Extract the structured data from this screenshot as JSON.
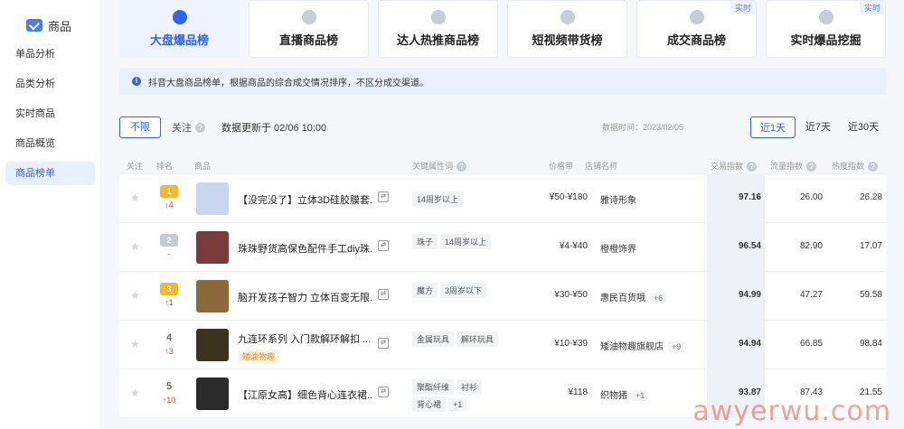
{
  "sidebar": {
    "title": "商品",
    "items": [
      {
        "label": "单品分析",
        "active": false
      },
      {
        "label": "品类分析",
        "active": false
      },
      {
        "label": "实时商品",
        "active": false
      },
      {
        "label": "商品概览",
        "active": false
      },
      {
        "label": "商品榜单",
        "active": true
      }
    ]
  },
  "tabs": [
    {
      "label": "大盘爆品榜",
      "active": true,
      "badge": ""
    },
    {
      "label": "直播商品榜",
      "active": false,
      "badge": ""
    },
    {
      "label": "达人热推商品榜",
      "active": false,
      "badge": ""
    },
    {
      "label": "短视频带货榜",
      "active": false,
      "badge": ""
    },
    {
      "label": "成交商品榜",
      "active": false,
      "badge": "实时"
    },
    {
      "label": "实时爆品挖掘",
      "active": false,
      "badge": "实时"
    }
  ],
  "notice": {
    "icon": "i",
    "text": "抖音大盘商品榜单，根据商品的综合成交情况排序，不区分成交渠道。"
  },
  "filter": {
    "all_label": "不限",
    "follow_label": "关注",
    "update_text": "数据更新于 02/06 10:00",
    "date_text": "数据时间：2023/02/05",
    "ranges": [
      {
        "label": "近1天",
        "active": true
      },
      {
        "label": "近7天",
        "active": false
      },
      {
        "label": "近30天",
        "active": false
      }
    ]
  },
  "table": {
    "headers": {
      "follow": "关注",
      "rank": "排名",
      "product": "商品",
      "attrs": "关键属性词",
      "price": "价格带",
      "shop": "店铺名称",
      "trade": "交易指数",
      "traffic": "流量指数",
      "heat": "热度指数"
    },
    "rows": [
      {
        "crown": "1",
        "crown_color": "gold",
        "rank": "",
        "delta": "↑4",
        "name": "【没完没了】立体3D硅胶膜套...",
        "shop_tag": "",
        "attrs": [
          "14周岁以上"
        ],
        "price": "¥50-¥180",
        "shop": "雅诗形象",
        "shop_more": "",
        "trade": "97.16",
        "traffic": "26.00",
        "heat": "26.28",
        "thumb": "#c9d6f2"
      },
      {
        "crown": "2",
        "crown_color": "silver",
        "rank": "",
        "delta": "-",
        "name": "珠珠野货高保色配件手工diy珠...",
        "shop_tag": "",
        "attrs": [
          "珠子",
          "14周岁以上"
        ],
        "price": "¥4-¥40",
        "shop": "橙橙饰界",
        "shop_more": "",
        "trade": "96.54",
        "traffic": "82.90",
        "heat": "17.07",
        "thumb": "#7a3b3b"
      },
      {
        "crown": "3",
        "crown_color": "gold",
        "rank": "",
        "delta": "↑1",
        "name": "脑开发孩子智力 立体百变无限...",
        "shop_tag": "",
        "attrs": [
          "魔方",
          "3周岁以下"
        ],
        "price": "¥30-¥50",
        "shop": "惠民百货哦",
        "shop_more": "+6",
        "trade": "94.99",
        "traffic": "47.27",
        "heat": "59.58",
        "thumb": "#8a6a3a"
      },
      {
        "crown": "",
        "crown_color": "",
        "rank": "4",
        "delta": "↑3",
        "name": "九连环系列 入门款解环解扣 ...",
        "shop_tag": "矮油物趣",
        "attrs": [
          "金属玩具",
          "解环玩具"
        ],
        "price": "¥10-¥39",
        "shop": "矮油物趣旗舰店",
        "shop_more": "+9",
        "trade": "94.94",
        "traffic": "66.85",
        "heat": "98.84",
        "thumb": "#3a3320"
      },
      {
        "crown": "",
        "crown_color": "",
        "rank": "5",
        "delta": "↑10",
        "name": "【江原女高】细色背心连衣裙...",
        "shop_tag": "",
        "attrs": [
          "聚酯纤维",
          "衬衫",
          "背心裙",
          "+1"
        ],
        "price": "¥118",
        "shop": "织物猪",
        "shop_more": "+1",
        "trade": "93.87",
        "traffic": "87.43",
        "heat": "21.55",
        "thumb": "#2b2b2b"
      }
    ]
  },
  "watermark": "awyerwu.com"
}
